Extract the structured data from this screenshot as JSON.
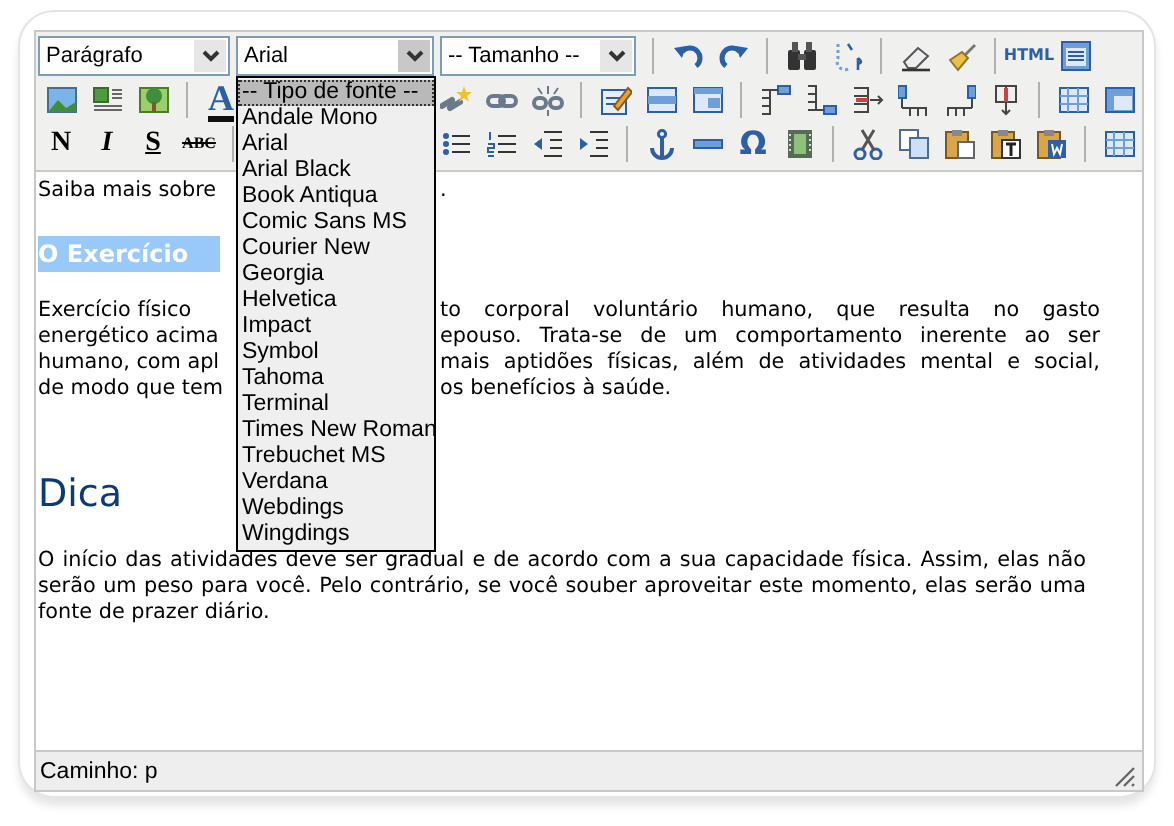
{
  "toolbar": [
    {
      "left": [
        {
          "kind": "select",
          "value": "Parágrafo",
          "expanded": false
        },
        {
          "kind": "select",
          "value": "Arial",
          "expanded": true
        },
        {
          "kind": "select",
          "value": "-- Tamanho --",
          "expanded": false
        },
        {
          "kind": "separator"
        },
        {
          "kind": "icon"
        },
        {
          "kind": "icon"
        },
        {
          "kind": "separator"
        },
        {
          "kind": "icon"
        },
        {
          "kind": "icon"
        },
        {
          "kind": "separator"
        },
        {
          "kind": "icon"
        },
        {
          "kind": "icon"
        },
        {
          "kind": "separator"
        },
        {
          "kind": "text",
          "label": "HTML"
        },
        {
          "kind": "icon"
        }
      ]
    },
    {
      "left": [
        {
          "kind": "icon"
        },
        {
          "kind": "icon"
        },
        {
          "kind": "icon"
        },
        {
          "kind": "separator"
        },
        {
          "kind": "text",
          "label": "A"
        }
      ],
      "right": [
        {
          "kind": "icon"
        },
        {
          "kind": "icon"
        },
        {
          "kind": "icon"
        },
        {
          "kind": "separator"
        },
        {
          "kind": "icon"
        },
        {
          "kind": "icon"
        },
        {
          "kind": "icon"
        },
        {
          "kind": "separator"
        },
        {
          "kind": "icon"
        },
        {
          "kind": "icon"
        },
        {
          "kind": "icon"
        },
        {
          "kind": "icon"
        },
        {
          "kind": "icon"
        },
        {
          "kind": "icon"
        },
        {
          "kind": "separator"
        },
        {
          "kind": "icon"
        },
        {
          "kind": "icon"
        }
      ]
    },
    {
      "left": [
        {
          "kind": "text",
          "label": "N"
        },
        {
          "kind": "text",
          "label": "I"
        },
        {
          "kind": "text",
          "label": "S"
        },
        {
          "kind": "text",
          "label": "ABC"
        },
        {
          "kind": "separator"
        }
      ],
      "right": [
        {
          "kind": "icon"
        },
        {
          "kind": "icon"
        },
        {
          "kind": "icon"
        },
        {
          "kind": "icon"
        },
        {
          "kind": "separator"
        },
        {
          "kind": "icon"
        },
        {
          "kind": "icon"
        },
        {
          "kind": "text",
          "label": "Ω"
        },
        {
          "kind": "icon"
        },
        {
          "kind": "separator"
        },
        {
          "kind": "icon"
        },
        {
          "kind": "icon"
        },
        {
          "kind": "icon"
        },
        {
          "kind": "icon"
        },
        {
          "kind": "icon"
        },
        {
          "kind": "separator"
        },
        {
          "kind": "icon"
        }
      ]
    }
  ],
  "font_dropdown": {
    "options": [
      {
        "label": "-- Tipo de fonte --",
        "selected": true
      },
      {
        "label": "Andale Mono",
        "selected": false
      },
      {
        "label": "Arial",
        "selected": false
      },
      {
        "label": "Arial Black",
        "selected": false
      },
      {
        "label": "Book Antiqua",
        "selected": false
      },
      {
        "label": "Comic Sans MS",
        "selected": false
      },
      {
        "label": "Courier New",
        "selected": false
      },
      {
        "label": "Georgia",
        "selected": false
      },
      {
        "label": "Helvetica",
        "selected": false
      },
      {
        "label": "Impact",
        "selected": false
      },
      {
        "label": "Symbol",
        "selected": false
      },
      {
        "label": "Tahoma",
        "selected": false
      },
      {
        "label": "Terminal",
        "selected": false
      },
      {
        "label": "Times New Roman",
        "selected": false
      },
      {
        "label": "Trebuchet MS",
        "selected": false
      },
      {
        "label": "Verdana",
        "selected": false
      },
      {
        "label": "Webdings",
        "selected": false
      },
      {
        "label": "Wingdings",
        "selected": false
      }
    ]
  },
  "content": [
    {
      "kind": "split_line",
      "left": "Saiba mais sobre",
      "right": "."
    },
    {
      "kind": "highlight_heading",
      "text": "O Exercício"
    },
    {
      "kind": "split_paragraph",
      "lines": [
        {
          "left": "Exercício físico",
          "right": "to corporal voluntário humano, que resulta no gasto"
        },
        {
          "left": "energético acima",
          "right": "epouso. Trata-se de um comportamento inerente ao ser"
        },
        {
          "left": "humano, com apl",
          "right": "mais aptidões físicas, além de atividades mental e social,"
        },
        {
          "left": "de modo que tem",
          "right": "os benefícios à saúde."
        }
      ]
    },
    {
      "kind": "heading",
      "text": "Dica"
    },
    {
      "kind": "paragraph",
      "text": "O início das atividades deve ser gradual e de acordo com a sua capacidade física. Assim, elas não serão um peso para você. Pelo contrário, se você souber aproveitar este momento, elas serão uma fonte de prazer diário."
    }
  ],
  "status_bar": {
    "path": "Caminho: p"
  }
}
